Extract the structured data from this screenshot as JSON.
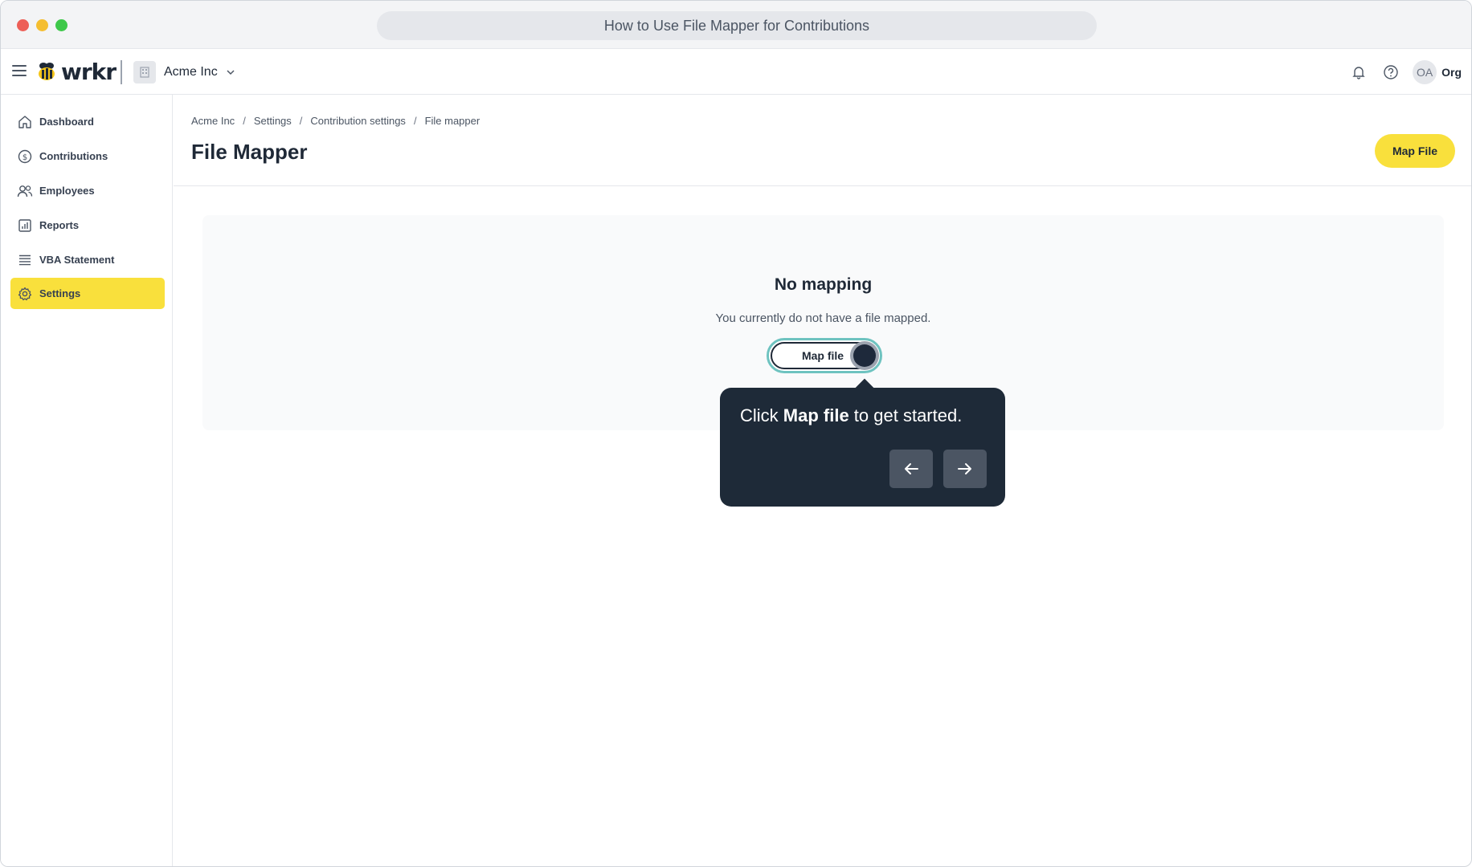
{
  "window": {
    "title": "How to Use File Mapper for Contributions"
  },
  "header": {
    "logo_text": "wrkr",
    "org_name": "Acme Inc",
    "avatar_initials": "OA",
    "avatar_label": "Org"
  },
  "sidebar": {
    "items": [
      {
        "label": "Dashboard",
        "icon": "home-icon"
      },
      {
        "label": "Contributions",
        "icon": "dollar-circle-icon"
      },
      {
        "label": "Employees",
        "icon": "users-icon"
      },
      {
        "label": "Reports",
        "icon": "bar-chart-icon"
      },
      {
        "label": "VBA Statement",
        "icon": "list-icon"
      },
      {
        "label": "Settings",
        "icon": "gear-icon",
        "active": true
      }
    ]
  },
  "breadcrumb": [
    "Acme Inc",
    "Settings",
    "Contribution settings",
    "File mapper"
  ],
  "page": {
    "title": "File Mapper",
    "map_file_button": "Map File"
  },
  "empty_state": {
    "title": "No mapping",
    "subtitle": "You currently do not have a file mapped.",
    "button": "Map file"
  },
  "tooltip": {
    "prefix": "Click ",
    "bold": "Map file",
    "suffix": " to get started."
  },
  "colors": {
    "accent": "#f9e03c",
    "tooltip_bg": "#1e2a38",
    "focus_ring": "#6ec3c0"
  }
}
